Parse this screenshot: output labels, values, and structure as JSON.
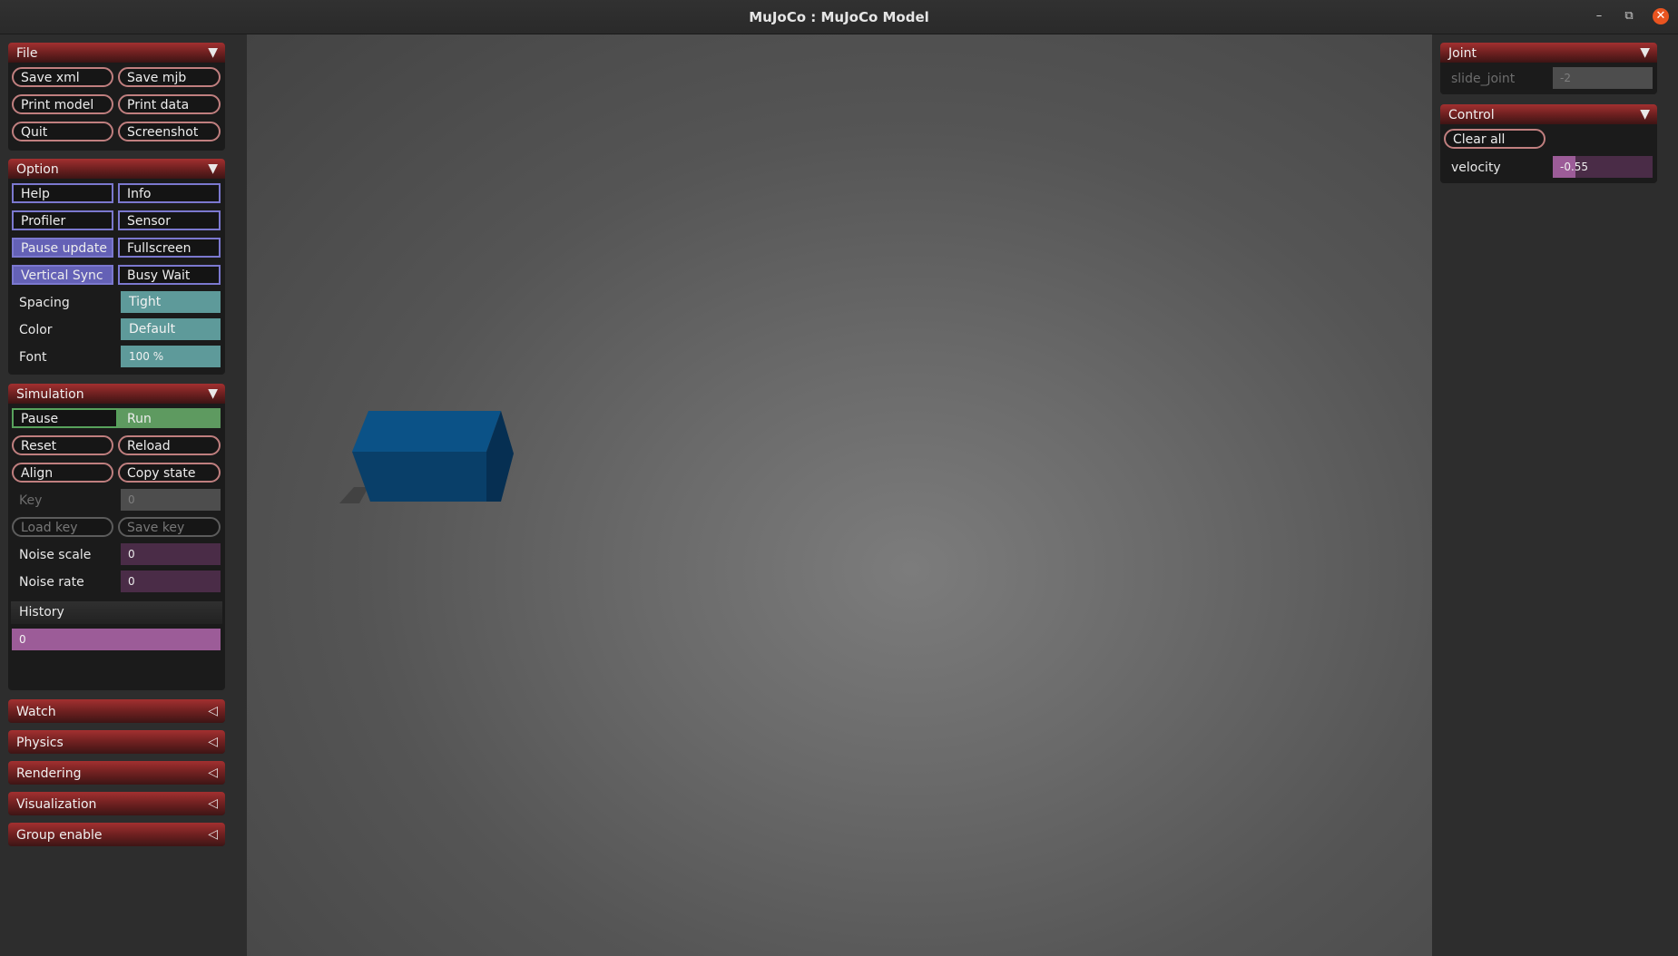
{
  "window": {
    "title": "MuJoCo : MuJoCo Model",
    "minimize": "–",
    "restore": "⧉",
    "close": "✕"
  },
  "file": {
    "title": "File",
    "arrow": "▼",
    "save_xml": "Save xml",
    "save_mjb": "Save mjb",
    "print_model": "Print model",
    "print_data": "Print data",
    "quit": "Quit",
    "screenshot": "Screenshot"
  },
  "option": {
    "title": "Option",
    "arrow": "▼",
    "help": "Help",
    "info": "Info",
    "profiler": "Profiler",
    "sensor": "Sensor",
    "pause_update": "Pause update",
    "fullscreen": "Fullscreen",
    "vertical_sync": "Vertical Sync",
    "busy_wait": "Busy Wait",
    "spacing_label": "Spacing",
    "spacing_value": "Tight",
    "color_label": "Color",
    "color_value": "Default",
    "font_label": "Font",
    "font_value": "100 %"
  },
  "simulation": {
    "title": "Simulation",
    "arrow": "▼",
    "pause": "Pause",
    "run": "Run",
    "reset": "Reset",
    "reload": "Reload",
    "align": "Align",
    "copy_state": "Copy state",
    "key_label": "Key",
    "key_value": "0",
    "load_key": "Load key",
    "save_key": "Save key",
    "noise_scale_label": "Noise scale",
    "noise_scale_value": "0",
    "noise_rate_label": "Noise rate",
    "noise_rate_value": "0",
    "history_label": "History",
    "history_value": "0"
  },
  "collapsed": {
    "arrow": "◁",
    "watch": "Watch",
    "physics": "Physics",
    "rendering": "Rendering",
    "visualization": "Visualization",
    "group_enable": "Group enable"
  },
  "joint": {
    "title": "Joint",
    "arrow": "▼",
    "name": "slide_joint",
    "value": "-2"
  },
  "control": {
    "title": "Control",
    "arrow": "▼",
    "clear_all": "Clear all",
    "velocity_label": "velocity",
    "velocity_value": "-0.55",
    "velocity_fraction": 0.225
  },
  "colors": {
    "header_red": "#a33030",
    "check_on": "#6461b6",
    "select": "#5e9a9a",
    "run_green": "#5e9a60",
    "slider_fill": "#9c5c98",
    "box_blue": "#0a4d7e"
  }
}
